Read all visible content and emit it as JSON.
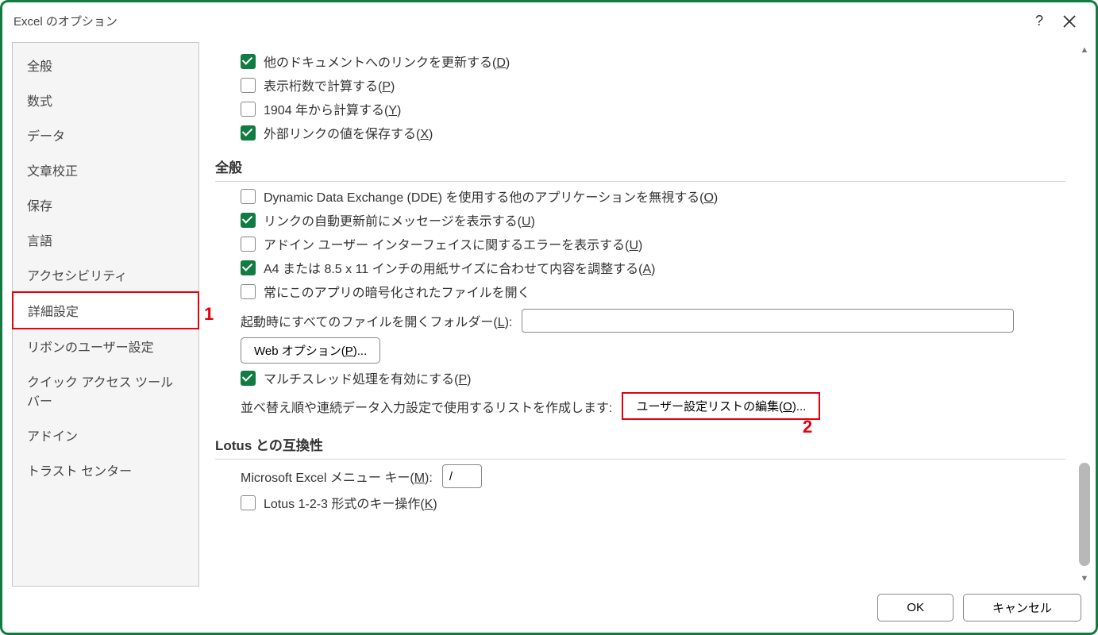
{
  "dialog": {
    "title": "Excel のオプション"
  },
  "sidebar": {
    "items": [
      {
        "label": "全般"
      },
      {
        "label": "数式"
      },
      {
        "label": "データ"
      },
      {
        "label": "文章校正"
      },
      {
        "label": "保存"
      },
      {
        "label": "言語"
      },
      {
        "label": "アクセシビリティ"
      },
      {
        "label": "詳細設定"
      },
      {
        "label": "リボンのユーザー設定"
      },
      {
        "label": "クイック アクセス ツール バー"
      },
      {
        "label": "アドイン"
      },
      {
        "label": "トラスト センター"
      }
    ],
    "active_index": 7
  },
  "annotations": {
    "marker1": "1",
    "marker2": "2"
  },
  "content": {
    "group_top": {
      "cb_update_links": {
        "checked": true,
        "text": "他のドキュメントへのリンクを更新する(",
        "key": "D",
        "tail": ")"
      },
      "cb_precision": {
        "checked": false,
        "text": "表示桁数で計算する(",
        "key": "P",
        "tail": ")"
      },
      "cb_1904": {
        "checked": false,
        "text": "1904 年から計算する(",
        "key": "Y",
        "tail": ")"
      },
      "cb_save_ext": {
        "checked": true,
        "text": "外部リンクの値を保存する(",
        "key": "X",
        "tail": ")"
      }
    },
    "section_general": "全般",
    "group_general": {
      "cb_dde": {
        "checked": false,
        "text": "Dynamic Data Exchange (DDE) を使用する他のアプリケーションを無視する(",
        "key": "O",
        "tail": ")"
      },
      "cb_linkmsg": {
        "checked": true,
        "text": "リンクの自動更新前にメッセージを表示する(",
        "key": "U",
        "tail": ")"
      },
      "cb_addin_err": {
        "checked": false,
        "text": "アドイン ユーザー インターフェイスに関するエラーを表示する(",
        "key": "U",
        "tail": ")"
      },
      "cb_a4": {
        "checked": true,
        "text": "A4 または 8.5 x 11 インチの用紙サイズに合わせて内容を調整する(",
        "key": "A",
        "tail": ")"
      },
      "cb_encrypted": {
        "checked": false,
        "text": "常にこのアプリの暗号化されたファイルを開く"
      },
      "startup_label": {
        "text": "起動時にすべてのファイルを開くフォルダー(",
        "key": "L",
        "tail": "):"
      },
      "startup_value": "",
      "web_options": {
        "text": "Web オプション(",
        "key": "P",
        "tail": ")..."
      },
      "cb_multithread": {
        "checked": true,
        "text": "マルチスレッド処理を有効にする(",
        "key": "P",
        "tail": ")"
      },
      "sort_label": "並べ替え順や連続データ入力設定で使用するリストを作成します:",
      "edit_custom_list": {
        "text": "ユーザー設定リストの編集(",
        "key": "O",
        "tail": ")..."
      }
    },
    "section_lotus": "Lotus との互換性",
    "group_lotus": {
      "menu_key_label": {
        "text": "Microsoft Excel メニュー キー(",
        "key": "M",
        "tail": "):"
      },
      "menu_key_value": "/",
      "cb_lotus_keys": {
        "checked": false,
        "text": "Lotus 1-2-3 形式のキー操作(",
        "key": "K",
        "tail": ")"
      }
    }
  },
  "footer": {
    "ok": "OK",
    "cancel": "キャンセル"
  }
}
